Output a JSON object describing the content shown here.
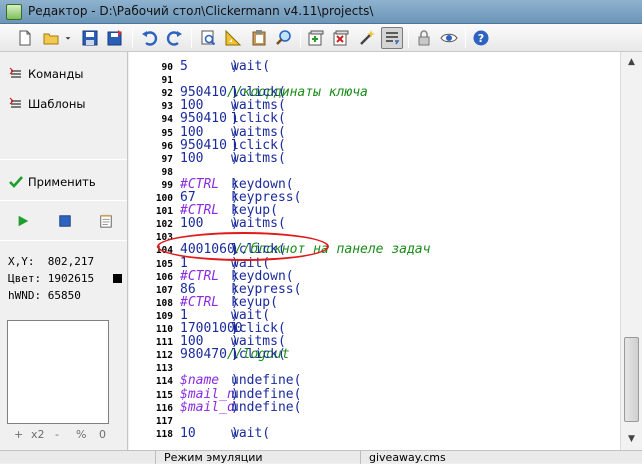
{
  "window": {
    "title": "Редактор - D:\\Рабочий стол\\Clickermann v4.11\\projects\\"
  },
  "toolbar": {
    "buttons": [
      "new-file",
      "open-folder",
      "save",
      "save-as",
      "undo",
      "redo",
      "find",
      "ruler",
      "clipboard",
      "search",
      "add-item",
      "remove-item",
      "magic-wand",
      "line-wrap",
      "lock",
      "eye",
      "help"
    ]
  },
  "sidebar": {
    "commands_label": "Команды",
    "templates_label": "Шаблоны",
    "apply_label": "Применить",
    "xy_label": "X,Y:",
    "xy_value": "802,217",
    "color_label": "Цвет:",
    "color_value": "1902615",
    "hwnd_label": "hWND:",
    "hwnd_value": "65850",
    "zoom": {
      "plus": "+",
      "x2": "x2",
      "minus": "-",
      "percent": "%",
      "zero": "0"
    }
  },
  "colors": {
    "code": "#1a2b9c",
    "comment": "#1a8c1a",
    "variable": "#8a2be2",
    "highlight_circle": "#e0191a"
  },
  "editor": {
    "lines": [
      {
        "n": "90",
        "parts": [
          {
            "t": "wait(",
            "c": "code"
          },
          {
            "t": "5",
            "c": "num"
          },
          {
            "t": ")",
            "c": "code"
          }
        ]
      },
      {
        "n": "91",
        "parts": []
      },
      {
        "n": "92",
        "parts": [
          {
            "t": "lclick(",
            "c": "code"
          },
          {
            "t": "950",
            "c": "num"
          },
          {
            "t": ", ",
            "c": "code"
          },
          {
            "t": "410",
            "c": "num"
          },
          {
            "t": ")",
            "c": "code"
          },
          {
            "t": "//координаты ключа",
            "c": "cmt"
          }
        ]
      },
      {
        "n": "93",
        "parts": [
          {
            "t": "waitms(",
            "c": "code"
          },
          {
            "t": "100",
            "c": "num"
          },
          {
            "t": ")",
            "c": "code"
          }
        ]
      },
      {
        "n": "94",
        "parts": [
          {
            "t": "lclick(",
            "c": "code"
          },
          {
            "t": "950",
            "c": "num"
          },
          {
            "t": ", ",
            "c": "code"
          },
          {
            "t": "410",
            "c": "num"
          },
          {
            "t": ")",
            "c": "code"
          }
        ]
      },
      {
        "n": "95",
        "parts": [
          {
            "t": "waitms(",
            "c": "code"
          },
          {
            "t": "100",
            "c": "num"
          },
          {
            "t": ")",
            "c": "code"
          }
        ]
      },
      {
        "n": "96",
        "parts": [
          {
            "t": "lclick(",
            "c": "code"
          },
          {
            "t": "950",
            "c": "num"
          },
          {
            "t": ", ",
            "c": "code"
          },
          {
            "t": "410",
            "c": "num"
          },
          {
            "t": ")",
            "c": "code"
          }
        ]
      },
      {
        "n": "97",
        "parts": [
          {
            "t": "waitms(",
            "c": "code"
          },
          {
            "t": "100",
            "c": "num"
          },
          {
            "t": ")",
            "c": "code"
          }
        ]
      },
      {
        "n": "98",
        "parts": []
      },
      {
        "n": "99",
        "parts": [
          {
            "t": "keydown(",
            "c": "code"
          },
          {
            "t": "#CTRL",
            "c": "var"
          },
          {
            "t": ")",
            "c": "code"
          }
        ]
      },
      {
        "n": "100",
        "parts": [
          {
            "t": "keypress(",
            "c": "code"
          },
          {
            "t": "67",
            "c": "num"
          },
          {
            "t": ")",
            "c": "code"
          }
        ]
      },
      {
        "n": "101",
        "parts": [
          {
            "t": "keyup(",
            "c": "code"
          },
          {
            "t": "#CTRL",
            "c": "var"
          },
          {
            "t": ")",
            "c": "code"
          }
        ]
      },
      {
        "n": "102",
        "parts": [
          {
            "t": "waitms(",
            "c": "code"
          },
          {
            "t": "100",
            "c": "num"
          },
          {
            "t": ")",
            "c": "code"
          }
        ]
      },
      {
        "n": "103",
        "parts": []
      },
      {
        "n": "104",
        "parts": [
          {
            "t": "lclick(",
            "c": "code"
          },
          {
            "t": "400",
            "c": "num"
          },
          {
            "t": ", ",
            "c": "code"
          },
          {
            "t": "1060",
            "c": "num"
          },
          {
            "t": ")",
            "c": "code"
          },
          {
            "t": "//блокнот на панеле задач",
            "c": "cmt"
          }
        ]
      },
      {
        "n": "105",
        "parts": [
          {
            "t": "wait(",
            "c": "code"
          },
          {
            "t": "1",
            "c": "num"
          },
          {
            "t": ")",
            "c": "code"
          }
        ]
      },
      {
        "n": "106",
        "parts": [
          {
            "t": "keydown(",
            "c": "code"
          },
          {
            "t": "#CTRL",
            "c": "var"
          },
          {
            "t": ")",
            "c": "code"
          }
        ]
      },
      {
        "n": "107",
        "parts": [
          {
            "t": "keypress(",
            "c": "code"
          },
          {
            "t": "86",
            "c": "num"
          },
          {
            "t": ")",
            "c": "code"
          }
        ]
      },
      {
        "n": "108",
        "parts": [
          {
            "t": "keyup(",
            "c": "code"
          },
          {
            "t": "#CTRL",
            "c": "var"
          },
          {
            "t": ")",
            "c": "code"
          }
        ]
      },
      {
        "n": "109",
        "parts": [
          {
            "t": "wait(",
            "c": "code"
          },
          {
            "t": "1",
            "c": "num"
          },
          {
            "t": ")",
            "c": "code"
          }
        ]
      },
      {
        "n": "110",
        "parts": [
          {
            "t": "lclick(",
            "c": "code"
          },
          {
            "t": "1700",
            "c": "num"
          },
          {
            "t": ", ",
            "c": "code"
          },
          {
            "t": "1000",
            "c": "num"
          },
          {
            "t": ")",
            "c": "code"
          }
        ]
      },
      {
        "n": "111",
        "parts": [
          {
            "t": "waitms(",
            "c": "code"
          },
          {
            "t": "100",
            "c": "num"
          },
          {
            "t": ")",
            "c": "code"
          }
        ]
      },
      {
        "n": "112",
        "parts": [
          {
            "t": "lclick(",
            "c": "code"
          },
          {
            "t": "980",
            "c": "num"
          },
          {
            "t": ", ",
            "c": "code"
          },
          {
            "t": "470",
            "c": "num"
          },
          {
            "t": ")",
            "c": "code"
          },
          {
            "t": "//logout",
            "c": "cmt"
          }
        ]
      },
      {
        "n": "113",
        "parts": []
      },
      {
        "n": "114",
        "parts": [
          {
            "t": "undefine(",
            "c": "code"
          },
          {
            "t": "$name",
            "c": "var"
          },
          {
            "t": ")",
            "c": "code"
          }
        ]
      },
      {
        "n": "115",
        "parts": [
          {
            "t": "undefine(",
            "c": "code"
          },
          {
            "t": "$mail_n",
            "c": "var"
          },
          {
            "t": ")",
            "c": "code"
          }
        ]
      },
      {
        "n": "116",
        "parts": [
          {
            "t": "undefine(",
            "c": "code"
          },
          {
            "t": "$mail_d",
            "c": "var"
          },
          {
            "t": ")",
            "c": "code"
          }
        ]
      },
      {
        "n": "117",
        "parts": []
      },
      {
        "n": "118",
        "parts": [
          {
            "t": "wait(",
            "c": "code"
          },
          {
            "t": "10",
            "c": "num"
          },
          {
            "t": ")",
            "c": "code"
          }
        ]
      }
    ]
  },
  "status": {
    "col1": "",
    "col2": "Режим эмуляции",
    "col3": "giveaway.cms"
  }
}
